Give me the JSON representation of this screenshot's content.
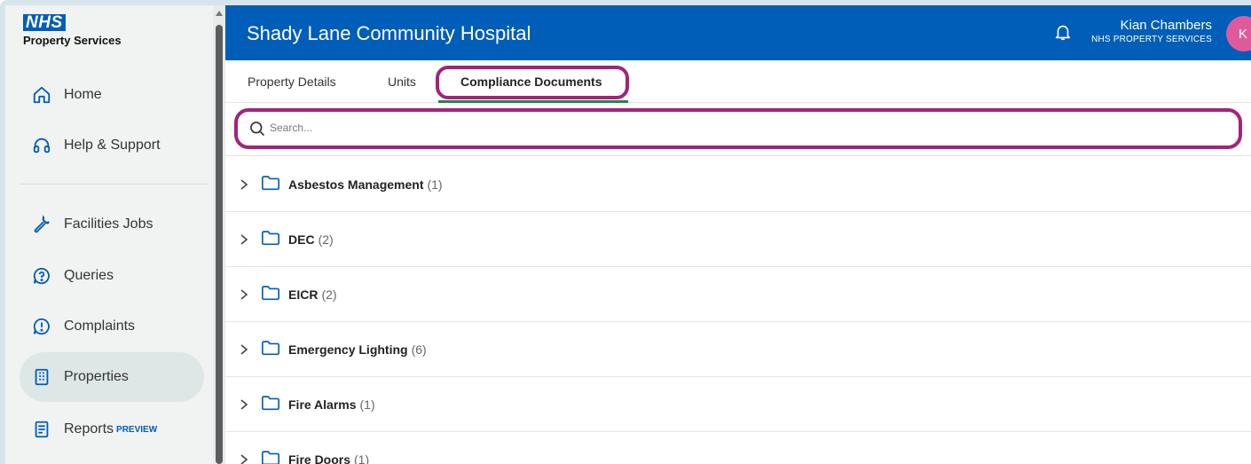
{
  "brand": {
    "logo_text": "NHS",
    "subtitle": "Property Services"
  },
  "sidebar": {
    "items": [
      {
        "label": "Home",
        "icon": "home-icon"
      },
      {
        "label": "Help & Support",
        "icon": "headset-icon"
      },
      {
        "label": "Facilities Jobs",
        "icon": "wrench-icon"
      },
      {
        "label": "Queries",
        "icon": "question-bubble-icon"
      },
      {
        "label": "Complaints",
        "icon": "exclamation-bubble-icon"
      },
      {
        "label": "Properties",
        "icon": "building-icon",
        "active": true
      },
      {
        "label": "Reports",
        "icon": "report-icon",
        "badge": "PREVIEW"
      }
    ]
  },
  "header": {
    "title": "Shady Lane Community Hospital",
    "user_name": "Kian Chambers",
    "user_org": "NHS PROPERTY SERVICES",
    "avatar_initial": "K",
    "bell_icon": "bell-icon"
  },
  "tabs": [
    {
      "label": "Property Details"
    },
    {
      "label": "Units"
    },
    {
      "label": "Compliance Documents",
      "active": true
    }
  ],
  "search": {
    "placeholder": "Search...",
    "value": ""
  },
  "folders": [
    {
      "name": "Asbestos Management",
      "count": "(1)"
    },
    {
      "name": "DEC",
      "count": "(2)"
    },
    {
      "name": "EICR",
      "count": "(2)"
    },
    {
      "name": "Emergency Lighting",
      "count": "(6)"
    },
    {
      "name": "Fire Alarms",
      "count": "(1)"
    },
    {
      "name": "Fire Doors",
      "count": "(1)"
    }
  ],
  "colors": {
    "header_bg": "#005eb8",
    "highlight": "#a3237a",
    "active_tab_underline": "#1b8a4a",
    "avatar_bg": "#e05a9b",
    "folder_icon": "#005eb8"
  }
}
